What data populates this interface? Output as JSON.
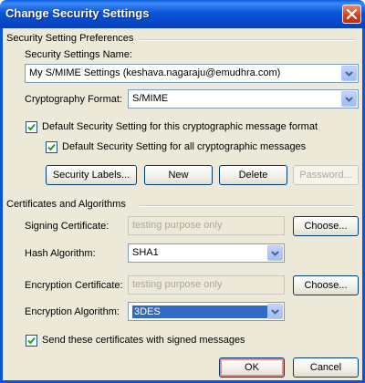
{
  "window": {
    "title": "Change Security Settings"
  },
  "prefs": {
    "section_title": "Security Setting Preferences",
    "name_label": "Security Settings Name:",
    "name_value": "My S/MIME Settings (keshava.nagaraju@emudhra.com)",
    "format_label": "Cryptography Format:",
    "format_value": "S/MIME",
    "default_format_label": "Default Security Setting for this cryptographic message format",
    "default_format_checked": true,
    "default_all_label": "Default Security Setting for all cryptographic messages",
    "default_all_checked": true,
    "security_labels_btn": "Security Labels...",
    "new_btn": "New",
    "delete_btn": "Delete",
    "password_btn": "Password..."
  },
  "certs": {
    "section_title": "Certificates and Algorithms",
    "signing_label": "Signing Certificate:",
    "signing_value": "testing purpose only",
    "choose_btn_1": "Choose...",
    "hash_label": "Hash Algorithm:",
    "hash_value": "SHA1",
    "enc_cert_label": "Encryption Certificate:",
    "enc_cert_value": "testing purpose only",
    "choose_btn_2": "Choose...",
    "enc_alg_label": "Encryption Algorithm:",
    "enc_alg_value": "3DES",
    "send_certs_label": "Send these certificates with signed messages",
    "send_certs_checked": true
  },
  "footer": {
    "ok_btn": "OK",
    "cancel_btn": "Cancel"
  }
}
